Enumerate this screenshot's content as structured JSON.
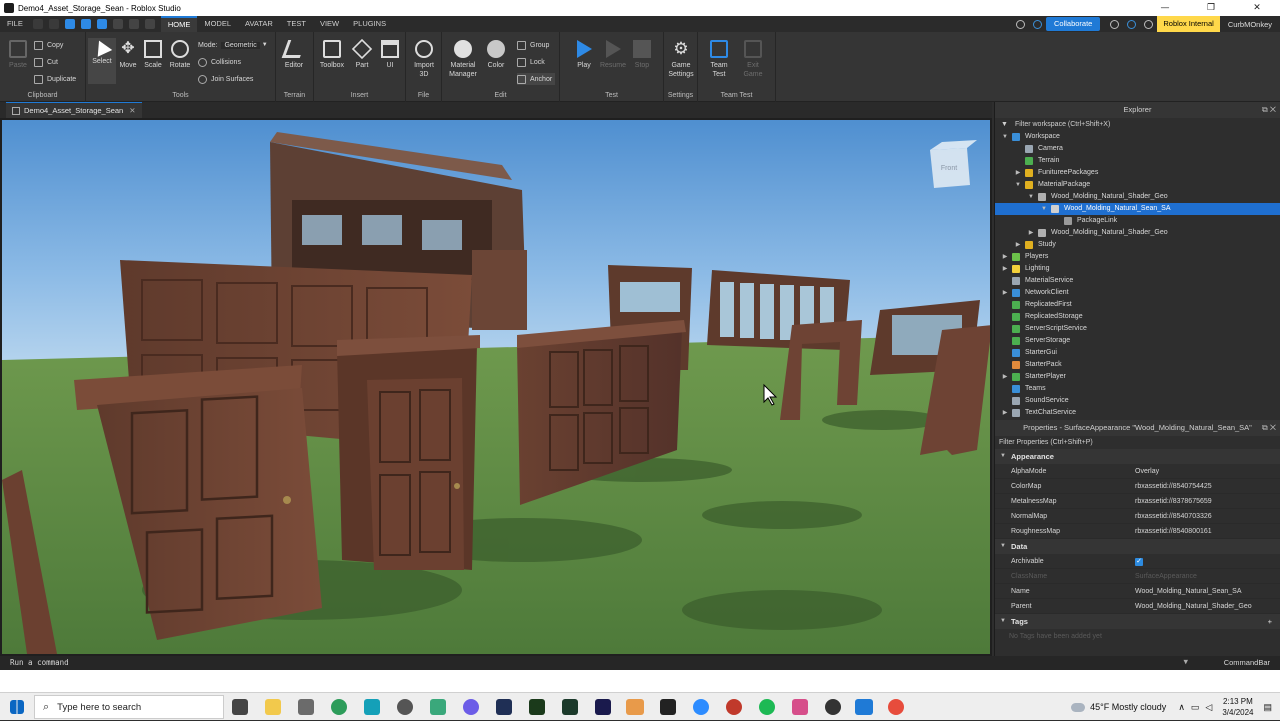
{
  "window": {
    "title": "Demo4_Asset_Storage_Sean - Roblox Studio",
    "minimize": "—",
    "maximize": "❐",
    "close": "✕"
  },
  "menu": {
    "file": "FILE",
    "tabs": [
      "HOME",
      "MODEL",
      "AVATAR",
      "TEST",
      "VIEW",
      "PLUGINS"
    ],
    "active_tab": "HOME",
    "collaborate": "Collaborate",
    "internal_badge": "Roblox Internal",
    "user": "CurbMOnkey"
  },
  "ribbon": {
    "clipboard": {
      "paste": "Paste",
      "copy": "Copy",
      "cut": "Cut",
      "duplicate": "Duplicate",
      "label": "Clipboard"
    },
    "tools": {
      "select": "Select",
      "move": "Move",
      "scale": "Scale",
      "rotate": "Rotate",
      "mode_label": "Mode:",
      "mode_value": "Geometric",
      "collisions": "Collisions",
      "join_surfaces": "Join Surfaces",
      "label": "Tools"
    },
    "terrain": {
      "editor": "Editor",
      "label": "Terrain"
    },
    "insert": {
      "toolbox": "Toolbox",
      "part": "Part",
      "ui": "UI",
      "label": "Insert"
    },
    "file": {
      "import_3d": "Import 3D",
      "label": "File"
    },
    "edit": {
      "material_manager": "Material Manager",
      "color": "Color",
      "group": "Group",
      "lock": "Lock",
      "anchor": "Anchor",
      "label": "Edit"
    },
    "test": {
      "play": "Play",
      "resume": "Resume",
      "stop": "Stop",
      "label": "Test"
    },
    "settings": {
      "game_settings": "Game Settings",
      "label": "Settings"
    },
    "team_test": {
      "team_test": "Team Test",
      "exit_game": "Exit Game",
      "label": "Team Test"
    }
  },
  "doc_tab": {
    "label": "Demo4_Asset_Storage_Sean",
    "close": "✕"
  },
  "viewport": {
    "view_cube_label": "Front"
  },
  "explorer": {
    "title": "Explorer",
    "filter": "Filter workspace (Ctrl+Shift+X)",
    "items": [
      {
        "label": "Workspace",
        "arrow": "▼",
        "level": 0,
        "color": "#3a8fd8"
      },
      {
        "label": "Camera",
        "arrow": "",
        "level": 1,
        "color": "#9aa6b2"
      },
      {
        "label": "Terrain",
        "arrow": "",
        "level": 1,
        "color": "#4caf50"
      },
      {
        "label": "FunitureePackages",
        "arrow": "▶",
        "level": 1,
        "color": "#e0b020"
      },
      {
        "label": "MaterialPackage",
        "arrow": "▼",
        "level": 1,
        "color": "#e0b020"
      },
      {
        "label": "Wood_Molding_Natural_Shader_Geo",
        "arrow": "▼",
        "level": 2,
        "color": "#b0b0b0"
      },
      {
        "label": "Wood_Molding_Natural_Sean_SA",
        "arrow": "▼",
        "level": 3,
        "color": "#d0d0d0",
        "selected": true
      },
      {
        "label": "PackageLink",
        "arrow": "",
        "level": 4,
        "color": "#9a9a9a"
      },
      {
        "label": "Wood_Molding_Natural_Shader_Geo",
        "arrow": "▶",
        "level": 2,
        "color": "#b0b0b0"
      },
      {
        "label": "Study",
        "arrow": "▶",
        "level": 1,
        "color": "#e0b020"
      },
      {
        "label": "Players",
        "arrow": "▶",
        "level": 0,
        "color": "#6cc24a"
      },
      {
        "label": "Lighting",
        "arrow": "▶",
        "level": 0,
        "color": "#f2d03b"
      },
      {
        "label": "MaterialService",
        "arrow": "",
        "level": 0,
        "color": "#9aa6b2"
      },
      {
        "label": "NetworkClient",
        "arrow": "▶",
        "level": 0,
        "color": "#3a8fd8"
      },
      {
        "label": "ReplicatedFirst",
        "arrow": "",
        "level": 0,
        "color": "#4caf50"
      },
      {
        "label": "ReplicatedStorage",
        "arrow": "",
        "level": 0,
        "color": "#4caf50"
      },
      {
        "label": "ServerScriptService",
        "arrow": "",
        "level": 0,
        "color": "#4caf50"
      },
      {
        "label": "ServerStorage",
        "arrow": "",
        "level": 0,
        "color": "#4caf50"
      },
      {
        "label": "StarterGui",
        "arrow": "",
        "level": 0,
        "color": "#3a8fd8"
      },
      {
        "label": "StarterPack",
        "arrow": "",
        "level": 0,
        "color": "#e08a3c"
      },
      {
        "label": "StarterPlayer",
        "arrow": "▶",
        "level": 0,
        "color": "#4caf50"
      },
      {
        "label": "Teams",
        "arrow": "",
        "level": 0,
        "color": "#3a8fd8"
      },
      {
        "label": "SoundService",
        "arrow": "",
        "level": 0,
        "color": "#9aa6b2"
      },
      {
        "label": "TextChatService",
        "arrow": "▶",
        "level": 0,
        "color": "#9aa6b2"
      }
    ]
  },
  "properties": {
    "title": "Properties - SurfaceAppearance \"Wood_Molding_Natural_Sean_SA\"",
    "filter": "Filter Properties (Ctrl+Shift+P)",
    "sections": {
      "appearance": "Appearance",
      "data": "Data",
      "tags": "Tags"
    },
    "appearance_rows": [
      {
        "key": "AlphaMode",
        "value": "Overlay"
      },
      {
        "key": "ColorMap",
        "value": "rbxassetid://8540754425"
      },
      {
        "key": "MetalnessMap",
        "value": "rbxassetid://8378675659"
      },
      {
        "key": "NormalMap",
        "value": "rbxassetid://8540703326"
      },
      {
        "key": "RoughnessMap",
        "value": "rbxassetid://8540800161"
      }
    ],
    "data_rows": {
      "archivable_key": "Archivable",
      "archivable_check": "✓",
      "classname_key": "ClassName",
      "classname_value": "SurfaceAppearance",
      "name_key": "Name",
      "name_value": "Wood_Molding_Natural_Sean_SA",
      "parent_key": "Parent",
      "parent_value": "Wood_Molding_Natural_Shader_Geo"
    },
    "tags_empty": "No Tags have been added yet",
    "tags_add": "+"
  },
  "command_bar": {
    "prompt": "Run a command",
    "label": "CommandBar"
  },
  "taskbar": {
    "search_placeholder": "Type here to search",
    "weather": "45°F  Mostly cloudy",
    "time": "2:13 PM",
    "date": "3/4/2024"
  }
}
